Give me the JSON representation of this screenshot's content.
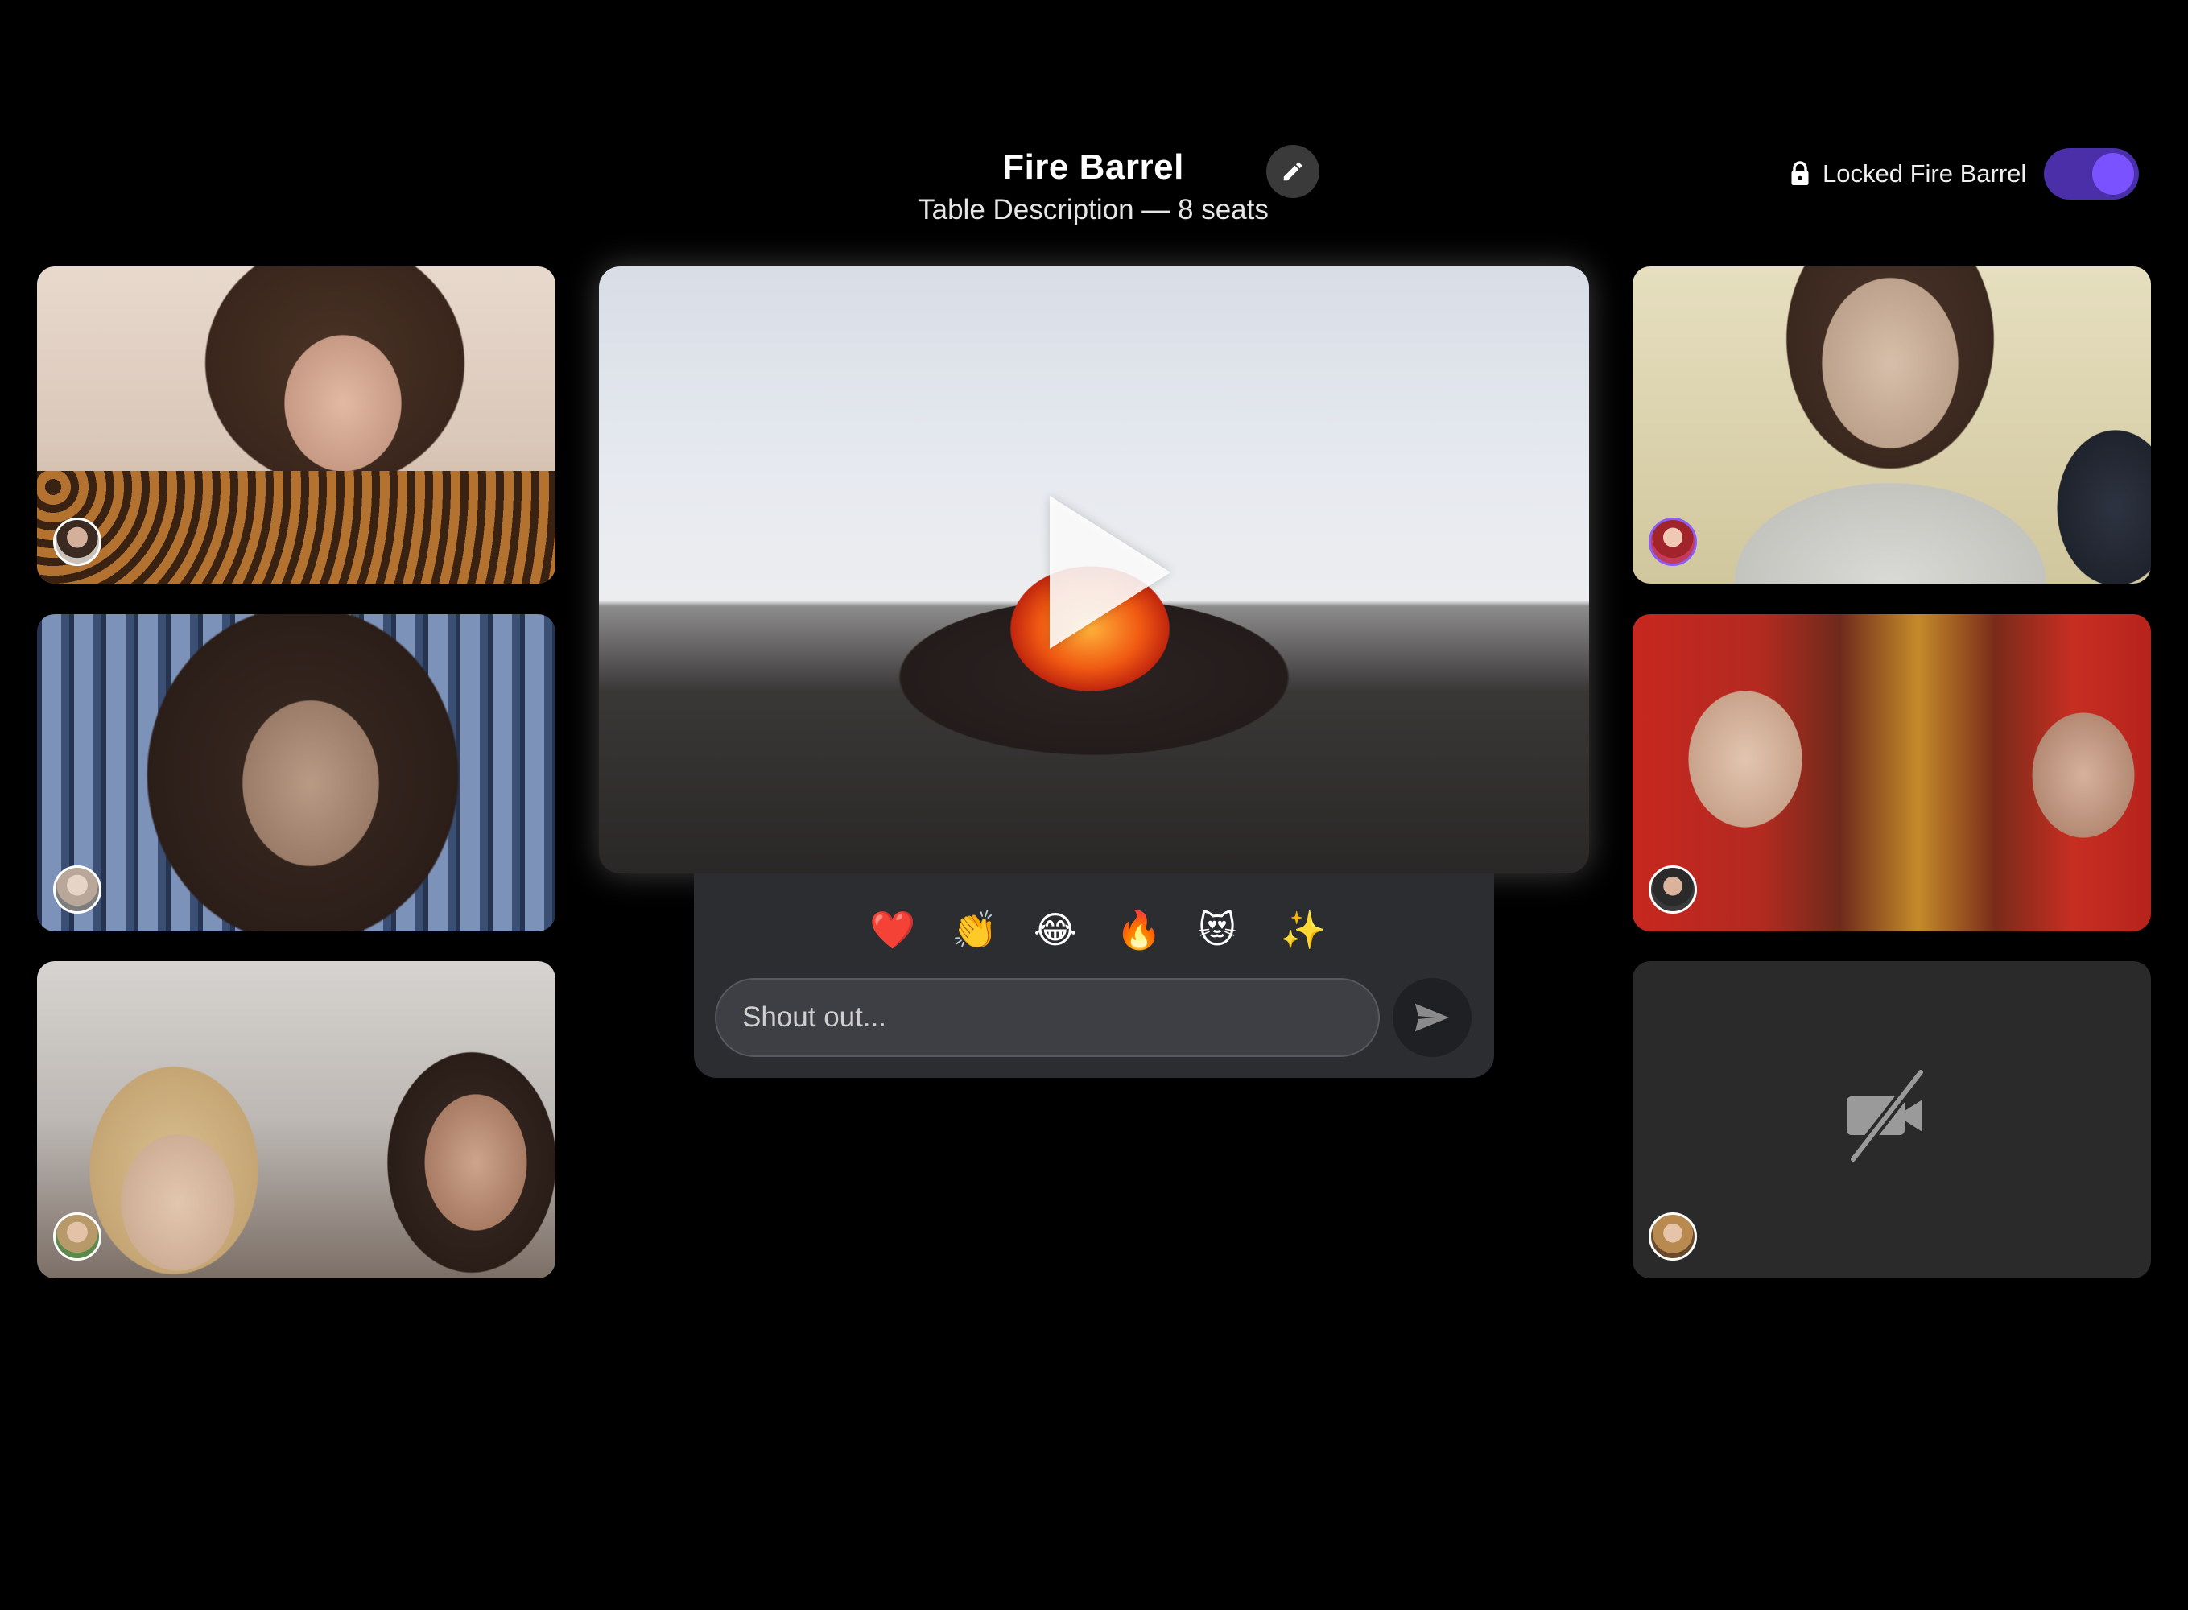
{
  "header": {
    "title": "Fire Barrel",
    "subtitle": "Table Description — 8 seats",
    "edit_icon": "pencil-icon",
    "lock_label": "Locked Fire Barrel",
    "lock_icon": "lock-icon",
    "lock_toggle_on": true
  },
  "participants_left": [
    {
      "name": "participant-1"
    },
    {
      "name": "participant-2"
    },
    {
      "name": "participant-3"
    }
  ],
  "participants_right": [
    {
      "name": "participant-4"
    },
    {
      "name": "participant-5"
    },
    {
      "name": "participant-6",
      "camera": "off",
      "icon": "camera-off-icon"
    }
  ],
  "media": {
    "play_icon": "play-icon"
  },
  "reactions": {
    "emojis": [
      "❤️",
      "👏",
      "😂",
      "🔥",
      "😻",
      "✨"
    ],
    "shout_placeholder": "Shout out...",
    "send_icon": "send-icon"
  },
  "colors": {
    "background": "#000000",
    "toggle_track": "#4a2fa8",
    "toggle_knob": "#7a52ff",
    "panel": "#2b2d31"
  }
}
